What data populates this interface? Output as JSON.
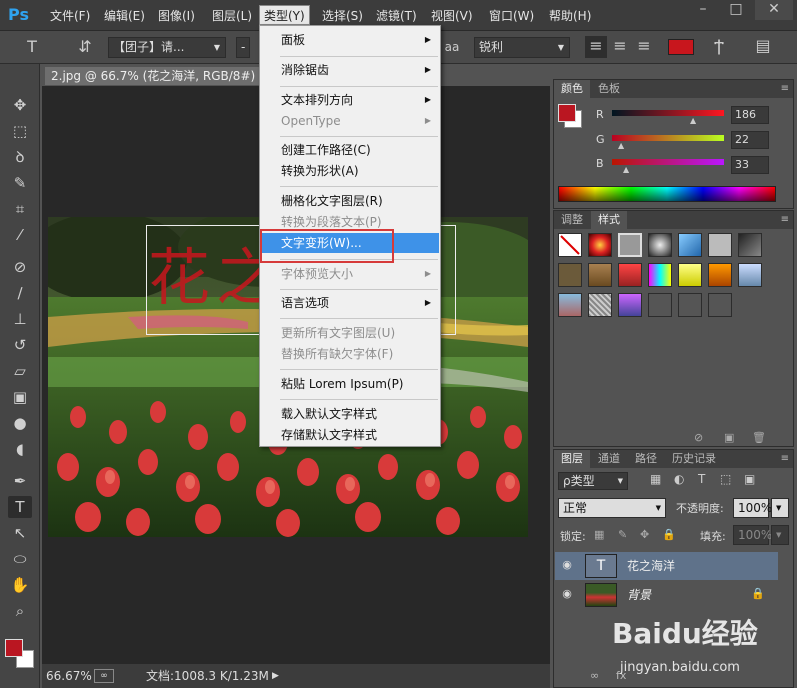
{
  "app": {
    "logo": "Ps"
  },
  "menubar": {
    "items": [
      "文件(F)",
      "编辑(E)",
      "图像(I)",
      "图层(L)",
      "类型(Y)",
      "选择(S)",
      "滤镜(T)",
      "视图(V)",
      "窗口(W)",
      "帮助(H)"
    ],
    "active": "类型(Y)"
  },
  "options": {
    "font_family": "【团子】请...",
    "font_style": "-",
    "antialias": "锐利",
    "aa_label": "aa",
    "color": "#c8161d"
  },
  "document": {
    "tab_title": "2.jpg @ 66.7% (花之海洋, RGB/8#) *",
    "text_layer_preview": "花之海洋",
    "zoom": "66.67%",
    "doc_size": "文档:1008.3 K/1.23M"
  },
  "dropdown": {
    "items": [
      {
        "label": "面板",
        "submenu": true,
        "enabled": true
      },
      {
        "label": "消除锯齿",
        "submenu": true,
        "enabled": true
      },
      {
        "label": "文本排列方向",
        "submenu": true,
        "enabled": true
      },
      {
        "label": "OpenType",
        "submenu": true,
        "enabled": false
      },
      {
        "label": "创建工作路径(C)",
        "submenu": false,
        "enabled": true
      },
      {
        "label": "转换为形状(A)",
        "submenu": false,
        "enabled": true
      },
      {
        "label": "栅格化文字图层(R)",
        "submenu": false,
        "enabled": true
      },
      {
        "label": "转换为段落文本(P)",
        "submenu": false,
        "enabled": false
      },
      {
        "label": "文字变形(W)...",
        "submenu": false,
        "enabled": true,
        "highlighted": true
      },
      {
        "label": "字体预览大小",
        "submenu": true,
        "enabled": false
      },
      {
        "label": "语言选项",
        "submenu": true,
        "enabled": true
      },
      {
        "label": "更新所有文字图层(U)",
        "submenu": false,
        "enabled": false
      },
      {
        "label": "替换所有缺欠字体(F)",
        "submenu": false,
        "enabled": false
      },
      {
        "label": "粘贴 Lorem Ipsum(P)",
        "submenu": false,
        "enabled": true
      },
      {
        "label": "载入默认文字样式",
        "submenu": false,
        "enabled": true
      },
      {
        "label": "存储默认文字样式",
        "submenu": false,
        "enabled": true
      }
    ]
  },
  "color_panel": {
    "tabs": [
      "颜色",
      "色板"
    ],
    "r_label": "R",
    "g_label": "G",
    "b_label": "B",
    "r": "186",
    "g": "22",
    "b": "33",
    "foreground": "#ba1621"
  },
  "styles_panel": {
    "tabs": [
      "调整",
      "样式"
    ]
  },
  "layers_panel": {
    "tabs": [
      "图层",
      "通道",
      "路径",
      "历史记录"
    ],
    "filter_kind": "ρ类型",
    "blend_mode": "正常",
    "opacity_label": "不透明度:",
    "opacity": "100%",
    "lock_label": "锁定:",
    "fill_label": "填充:",
    "fill": "100%",
    "layers": [
      {
        "name": "花之海洋",
        "type": "text",
        "selected": true
      },
      {
        "name": "背景",
        "type": "image",
        "selected": false
      }
    ]
  },
  "watermark": {
    "brand": "Baidu经验",
    "url": "jingyan.baidu.com"
  }
}
